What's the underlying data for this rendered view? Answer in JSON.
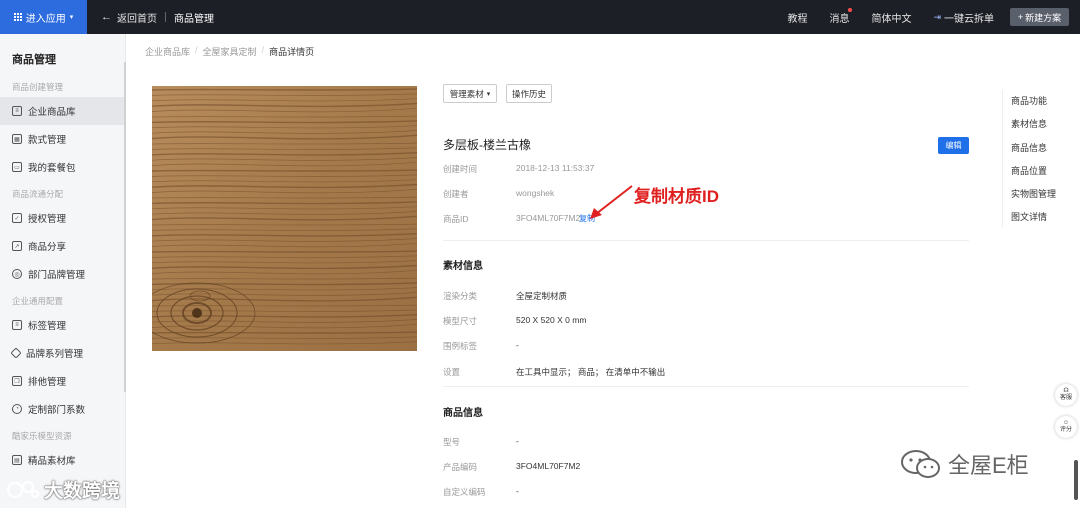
{
  "topbar": {
    "app_menu_label": "进入应用",
    "back_label": "返回首页",
    "current_section": "商品管理",
    "links": [
      "教程",
      "消息",
      "简体中文",
      "一键云拆单"
    ],
    "new_plan_label": "新建方案",
    "accent_color": "#2d6cdf"
  },
  "sidebar": {
    "title": "商品管理",
    "groups": [
      {
        "label": "商品创建管理",
        "items": [
          {
            "label": "企业商品库",
            "icon": "document-icon",
            "active": true
          },
          {
            "label": "款式管理",
            "icon": "grid-icon"
          },
          {
            "label": "我的套餐包",
            "icon": "package-icon"
          }
        ]
      },
      {
        "label": "商品流通分配",
        "items": [
          {
            "label": "授权管理",
            "icon": "check-square-icon"
          },
          {
            "label": "商品分享",
            "icon": "share-icon"
          },
          {
            "label": "部门品牌管理",
            "icon": "settings-icon"
          }
        ]
      },
      {
        "label": "企业通用配置",
        "items": [
          {
            "label": "标签管理",
            "icon": "tag-list-icon"
          },
          {
            "label": "品牌系列管理",
            "icon": "tag-icon"
          },
          {
            "label": "排他管理",
            "icon": "copy-icon"
          },
          {
            "label": "定制部门系数",
            "icon": "bell-icon"
          }
        ]
      },
      {
        "label": "酷家乐模型资源",
        "items": [
          {
            "label": "精品素材库",
            "icon": "library-icon"
          }
        ]
      }
    ]
  },
  "breadcrumb": [
    "企业商品库",
    "全屋家具定制",
    "商品详情页"
  ],
  "toolbar": {
    "manage_label": "管理素材",
    "history_label": "操作历史"
  },
  "product": {
    "title": "多层板-楼兰古橡",
    "edit_label": "编辑",
    "created_time_label": "创建时间",
    "created_time": "2018-12-13 11:53:37",
    "creator_label": "创建者",
    "creator": "wongshek",
    "id_label": "商品ID",
    "id": "3FO4ML70F7M2",
    "copy_label": "复制"
  },
  "annotation": {
    "text": "复制材质ID",
    "color": "#e02020"
  },
  "material_info": {
    "title": "素材信息",
    "rows": [
      {
        "label": "渲染分类",
        "value": "全屋定制材质"
      },
      {
        "label": "模型尺寸",
        "value": "520 X 520 X 0 mm"
      },
      {
        "label": "围例标签",
        "value": "-"
      },
      {
        "label": "设置",
        "value": "在工具中显示； 商品； 在清单中不输出"
      }
    ]
  },
  "product_info": {
    "title": "商品信息",
    "rows": [
      {
        "label": "型号",
        "value": "-"
      },
      {
        "label": "产品编码",
        "value": "3FO4ML70F7M2"
      },
      {
        "label": "自定义编码",
        "value": "-"
      }
    ]
  },
  "right_nav": [
    "商品功能",
    "素材信息",
    "商品信息",
    "商品位置",
    "实物图管理",
    "图文详情"
  ],
  "floating": {
    "help_label": "客服",
    "rate_label": "评分"
  },
  "watermarks": {
    "left": "大数跨境",
    "right": "全屋E柜"
  }
}
